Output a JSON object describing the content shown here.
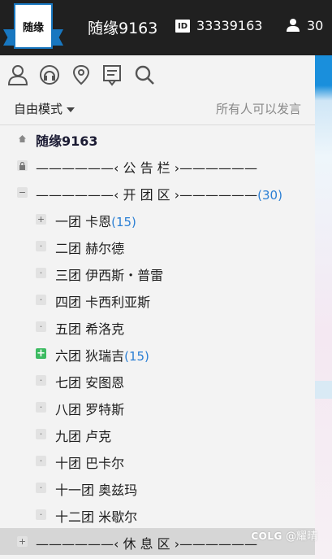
{
  "header": {
    "logo_text": "随缘",
    "channel_name": "随缘9163",
    "id_badge": "ID",
    "id_value": "33339163",
    "user_count": "30"
  },
  "toolbar": {
    "icons": [
      "user-icon",
      "headset-icon",
      "location-icon",
      "notice-board-icon",
      "search-icon"
    ]
  },
  "mode": {
    "label": "自由模式",
    "description": "所有人可以发言"
  },
  "tree": {
    "root": "随缘9163",
    "notice": "——————‹ 公 告 栏 ›——————",
    "open_group": {
      "label": "——————‹ 开 团 区 ›——————",
      "count": "(30)",
      "items": [
        {
          "label": "一团 卡恩",
          "count": "(15)"
        },
        {
          "label": "二团 赫尔德",
          "count": ""
        },
        {
          "label": "三团 伊西斯・普雷",
          "count": ""
        },
        {
          "label": "四团 卡西利亚斯",
          "count": ""
        },
        {
          "label": "五团 希洛克",
          "count": ""
        },
        {
          "label": "六团 狄瑞吉",
          "count": "(15)"
        },
        {
          "label": "七团 安图恩",
          "count": ""
        },
        {
          "label": "八团 罗特斯",
          "count": ""
        },
        {
          "label": "九团 卢克",
          "count": ""
        },
        {
          "label": "十团 巴卡尔",
          "count": ""
        },
        {
          "label": "十一团 奥兹玛",
          "count": ""
        },
        {
          "label": "十二团 米歇尔",
          "count": ""
        }
      ]
    },
    "rest_group": "——————‹ 休 息 区 ›——————"
  },
  "watermark": {
    "brand": "COLG",
    "handle": "@耀晴"
  },
  "colors": {
    "topbar": "#202020",
    "accent_blue": "#1877c0",
    "count_blue": "#2b7fd4",
    "green_badge": "#3dbb62"
  }
}
